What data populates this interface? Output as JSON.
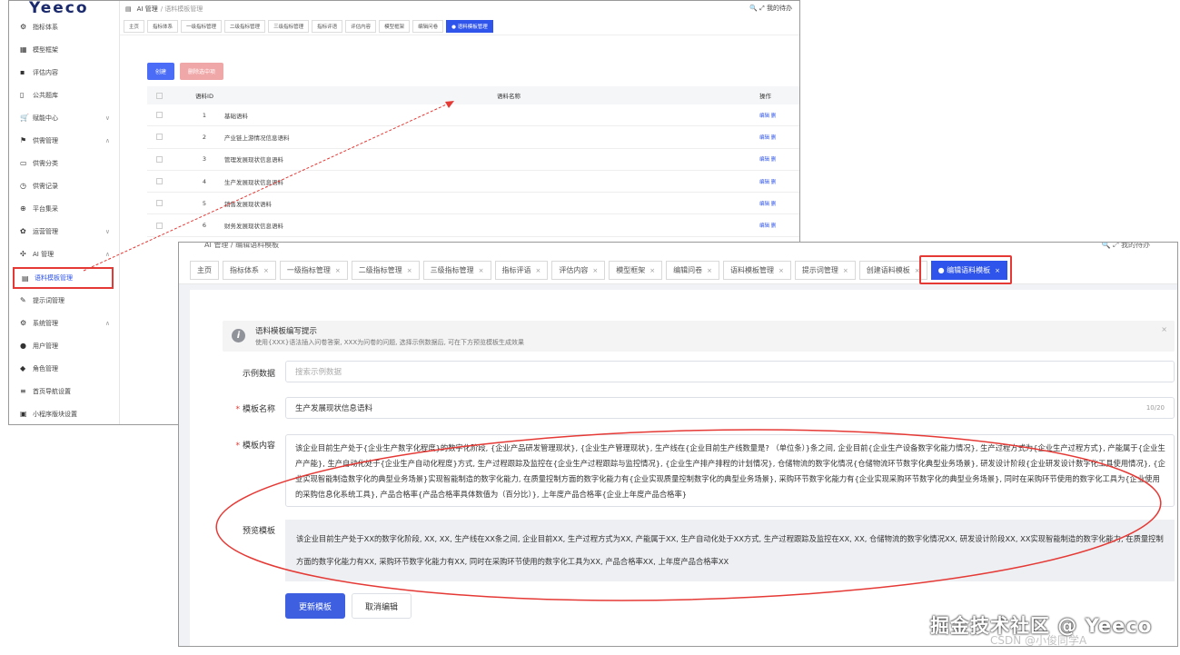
{
  "back": {
    "logo": "Yeeco",
    "header": {
      "title": "AI 管理",
      "breadcrumb": "/ 语料模板管理",
      "right": "我的待办"
    },
    "sidebar": [
      {
        "icon": "gear-icon",
        "glyph": "⚙",
        "label": "指标体系"
      },
      {
        "icon": "grid-icon",
        "glyph": "▦",
        "label": "模型框架"
      },
      {
        "icon": "chat-icon",
        "glyph": "▪",
        "label": "评估内容"
      },
      {
        "icon": "book-icon",
        "glyph": "▯",
        "label": "公共题库"
      },
      {
        "icon": "cart-icon",
        "glyph": "🛒",
        "label": "赋能中心",
        "chev": "∨"
      },
      {
        "icon": "flag-icon",
        "glyph": "⚑",
        "label": "供需管理",
        "chev": "∧"
      },
      {
        "icon": "list-icon",
        "glyph": "▭",
        "label": "供需分类"
      },
      {
        "icon": "clock-icon",
        "glyph": "◷",
        "label": "供需记录"
      },
      {
        "icon": "share-icon",
        "glyph": "⊕",
        "label": "平台集采"
      },
      {
        "icon": "cog-icon",
        "glyph": "✿",
        "label": "运营管理",
        "chev": "∨"
      },
      {
        "icon": "ai-icon",
        "glyph": "✣",
        "label": "AI 管理",
        "chev": "∧"
      },
      {
        "icon": "doc-icon",
        "glyph": "▤",
        "label": "语料模板管理",
        "active": true
      },
      {
        "icon": "magic-icon",
        "glyph": "✎",
        "label": "提示词管理"
      },
      {
        "icon": "settings-icon",
        "glyph": "⚙",
        "label": "系统管理",
        "chev": "∧"
      },
      {
        "icon": "user-icon",
        "glyph": "●",
        "label": "用户管理"
      },
      {
        "icon": "role-icon",
        "glyph": "◆",
        "label": "角色管理"
      },
      {
        "icon": "menu-icon",
        "glyph": "≡",
        "label": "首页导航设置"
      },
      {
        "icon": "app-icon",
        "glyph": "▣",
        "label": "小程序版块设置"
      }
    ],
    "tabs": [
      "主页",
      "指标体系",
      "一级指标管理",
      "二级指标管理",
      "三级指标管理",
      "指标评语",
      "评估内容",
      "模型框架",
      "编辑问卷",
      "● 语料模板管理"
    ],
    "buttons": {
      "add": "创建",
      "delete": "删除选中项"
    },
    "table": {
      "headers": {
        "id": "语料ID",
        "name": "语料名称",
        "ops": "操作"
      },
      "rows": [
        {
          "id": "1",
          "name": "基础语料"
        },
        {
          "id": "2",
          "name": "产业链上游情况信息语料"
        },
        {
          "id": "3",
          "name": "管理发展现状信息语料"
        },
        {
          "id": "4",
          "name": "生产发展现状信息语料"
        },
        {
          "id": "5",
          "name": "销售发展现状语料"
        },
        {
          "id": "6",
          "name": "财务发展现状信息语料"
        }
      ],
      "ops": {
        "edit": "编辑",
        "del": "删"
      }
    }
  },
  "front": {
    "header": {
      "title": "AI 管理",
      "breadcrumb": "/ 编辑语料模板",
      "right": "我的待办"
    },
    "tabs": [
      {
        "label": "主页",
        "close": false
      },
      {
        "label": "指标体系",
        "close": true
      },
      {
        "label": "一级指标管理",
        "close": true
      },
      {
        "label": "二级指标管理",
        "close": true
      },
      {
        "label": "三级指标管理",
        "close": true
      },
      {
        "label": "指标评语",
        "close": true
      },
      {
        "label": "评估内容",
        "close": true
      },
      {
        "label": "模型框架",
        "close": true
      },
      {
        "label": "编辑问卷",
        "close": true
      },
      {
        "label": "语料模板管理",
        "close": true
      },
      {
        "label": "提示词管理",
        "close": true
      },
      {
        "label": "创建语料模板",
        "close": true
      },
      {
        "label": "● 编辑语料模板",
        "close": true,
        "active": true
      }
    ],
    "tip": {
      "title": "语料模板编写提示",
      "desc": "使用{XXX}语法插入问卷答案, XXX为问卷的问题, 选择示例数据后, 可在下方预览模板生成效果",
      "close": "×"
    },
    "form": {
      "example_label": "示例数据",
      "example_placeholder": "搜索示例数据",
      "name_label": "模板名称",
      "name_value": "生产发展现状信息语料",
      "name_count": "10/20",
      "content_label": "模板内容",
      "content_value": "该企业目前生产处于{企业生产数字化程度}的数字化阶段, {企业产品研发管理现状}, {企业生产管理现状}, 生产线在{企业目前生产线数量是? （单位条）}条之间, 企业目前{企业生产设备数字化能力情况}, 生产过程方式为{企业生产过程方式}, 产能属于{企业生产产能}, 生产自动化处于{企业生产自动化程度}方式, 生产过程跟踪及监控在{企业生产过程跟踪与监控情况}, {企业生产排产排程的计划情况}, 仓储物流的数字化情况{仓储物流环节数字化典型业务场景}, 研发设计阶段{企业研发设计数字化工具使用情况}, {企业实现智能制造数字化的典型业务场景}实现智能制造的数字化能力, 在质量控制方面的数字化能力有{企业实现质量控制数字化的典型业务场景}, 采购环节数字化能力有{企业实现采购环节数字化的典型业务场景}, 同时在采购环节使用的数字化工具为{企业使用的采购信息化系统工具}, 产品合格率{产品合格率具体数值为（百分比）}, 上年度产品合格率{企业上年度产品合格率}",
      "preview_label": "预览模板",
      "preview_value": "该企业目前生产处于XX的数字化阶段, XX, XX, 生产线在XX条之间, 企业目前XX, 生产过程方式为XX, 产能属于XX, 生产自动化处于XX方式, 生产过程跟踪及监控在XX, XX, 仓储物流的数字化情况XX, 研发设计阶段XX, XX实现智能制造的数字化能力, 在质量控制方面的数字化能力有XX, 采购环节数字化能力有XX, 同时在采购环节使用的数字化工具为XX, 产品合格率XX, 上年度产品合格率XX",
      "update_button": "更新模板",
      "cancel_button": "取消编辑"
    }
  },
  "watermark": {
    "main": "掘金技术社区 @ Yeeco",
    "sub": "CSDN @小俊同学A"
  },
  "colors": {
    "accent": "#2f54eb",
    "annotation": "#e53935",
    "danger_button": "#f0a7a7"
  }
}
